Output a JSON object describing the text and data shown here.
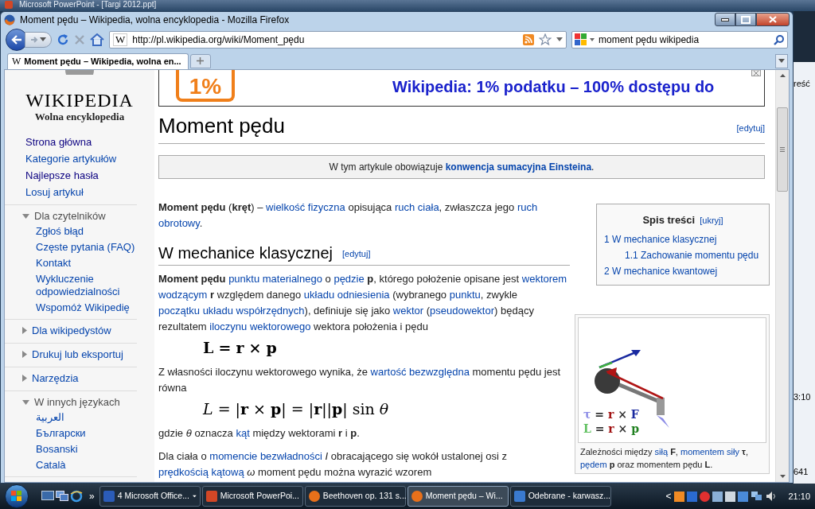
{
  "background_window": {
    "title": "Microsoft PowerPoint - [Targi 2012.ppt]"
  },
  "side_fragments": [
    "reść",
    "3:10",
    "641"
  ],
  "browser": {
    "title": "Moment pędu – Wikipedia, wolna encyklopedia - Mozilla Firefox",
    "url": "http://pl.wikipedia.org/wiki/Moment_pędu",
    "search": "moment pędu wikipedia",
    "favicon": "W",
    "tabs": [
      {
        "favicon": "W",
        "label": "Moment pędu – Wikipedia, wolna en...",
        "selected": true
      }
    ]
  },
  "sidebar": {
    "logo_title": "WIKIPEDIA",
    "logo_subtitle": "Wolna encyklopedia",
    "nav": [
      {
        "label": "Strona główna",
        "visited": true
      },
      {
        "label": "Kategorie artykułów",
        "visited": false
      },
      {
        "label": "Najlepsze hasła",
        "visited": true
      },
      {
        "label": "Losuj artykuł",
        "visited": false
      }
    ],
    "sections": [
      {
        "title": "Dla czytelników",
        "expanded": true,
        "items": [
          "Zgłoś błąd",
          "Częste pytania (FAQ)",
          "Kontakt",
          "Wykluczenie odpowiedzialności",
          "Wspomóż Wikipedię"
        ]
      },
      {
        "title": "Dla wikipedystów",
        "expanded": false
      },
      {
        "title": "Drukuj lub eksportuj",
        "expanded": false
      },
      {
        "title": "Narzędzia",
        "expanded": false
      },
      {
        "title": "W innych językach",
        "expanded": true,
        "items": [
          "العربية",
          "Български",
          "Bosanski",
          "Català"
        ]
      }
    ]
  },
  "banner": {
    "logo_text": "1%",
    "text": "Wikipedia: 1% podatku – 100% dostępu do"
  },
  "article": {
    "title": "Moment pędu",
    "edit": "[edytuj]",
    "notice": [
      {
        "kind": "text",
        "text": "W tym artykule obowiązuje "
      },
      {
        "kind": "link",
        "text": "**konwencja sumacyjna Einsteina**"
      },
      {
        "kind": "text",
        "text": "."
      }
    ],
    "toc": {
      "title": "Spis treści",
      "toggle": "[ukryj]",
      "items": [
        {
          "label": "1 W mechanice klasycznej",
          "children": [
            {
              "label": "1.1 Zachowanie momentu pędu"
            }
          ]
        },
        {
          "label": "2 W mechanice kwantowej"
        }
      ]
    },
    "intro": [
      {
        "kind": "text",
        "text": "**Moment pędu** (**kręt**) – "
      },
      {
        "kind": "link",
        "text": "wielkość fizyczna"
      },
      {
        "kind": "text",
        "text": " opisująca "
      },
      {
        "kind": "link",
        "text": "ruch ciała"
      },
      {
        "kind": "text",
        "text": ", zwłaszcza jego "
      },
      {
        "kind": "link",
        "text": "ruch"
      },
      {
        "kind": "link",
        "text": "obrotowy"
      },
      {
        "kind": "text",
        "text": "."
      }
    ],
    "section": {
      "title": "W mechanice klasycznej",
      "edit": "[edytuj]",
      "blocks": [
        {
          "kind": "paragraph",
          "parts": [
            {
              "kind": "text",
              "text": "**Moment pędu** "
            },
            {
              "kind": "link",
              "text": "punktu materialnego"
            },
            {
              "kind": "text",
              "text": " o "
            },
            {
              "kind": "link",
              "text": "pędzie"
            },
            {
              "kind": "text",
              "text": " **p**, którego położenie opisane jest "
            },
            {
              "kind": "link",
              "text": "wektorem"
            },
            {
              "kind": "link",
              "text": "wodzącym"
            },
            {
              "kind": "text",
              "text": " **r** względem danego "
            },
            {
              "kind": "link",
              "text": "układu odniesienia"
            },
            {
              "kind": "text",
              "text": " (wybranego "
            },
            {
              "kind": "link",
              "text": "punktu"
            },
            {
              "kind": "text",
              "text": ", zwykle "
            },
            {
              "kind": "link",
              "text": "początku układu współrzędnych"
            },
            {
              "kind": "text",
              "text": "), definiuje się jako "
            },
            {
              "kind": "link",
              "text": "wektor"
            },
            {
              "kind": "text",
              "text": " ("
            },
            {
              "kind": "link",
              "text": "pseudowektor"
            },
            {
              "kind": "text",
              "text": ") będący rezultatem "
            },
            {
              "kind": "link",
              "text": "iloczynu wektorowego"
            },
            {
              "kind": "text",
              "text": " wektora położenia i pędu"
            }
          ]
        },
        {
          "kind": "formula",
          "text": "**L** **=** **r** **×** **p**"
        },
        {
          "kind": "paragraph",
          "parts": [
            {
              "kind": "text",
              "text": "Z własności iloczynu wektorowego wynika, że "
            },
            {
              "kind": "link",
              "text": "wartość bezwzględna"
            },
            {
              "kind": "text",
              "text": " momentu pędu jest równa"
            }
          ]
        },
        {
          "kind": "formula",
          "text": "*L* = |**r** × **p**| = |**r**||**p**| sin *θ*"
        },
        {
          "kind": "paragraph",
          "parts": [
            {
              "kind": "text",
              "text": "gdzie *θ* oznacza "
            },
            {
              "kind": "link",
              "text": "kąt"
            },
            {
              "kind": "text",
              "text": " między wektorami **r** i **p**."
            }
          ]
        },
        {
          "kind": "paragraph",
          "parts": [
            {
              "kind": "text",
              "text": "Dla ciała o "
            },
            {
              "kind": "link",
              "text": "momencie bezwładności"
            },
            {
              "kind": "text",
              "text": " *I* obracającego się wokół ustalonej osi z "
            },
            {
              "kind": "link",
              "text": "prędkością kątową"
            },
            {
              "kind": "text",
              "text": " *ω* moment pędu można wyrazić wzorem"
            }
          ]
        }
      ]
    },
    "figure": {
      "labels": [
        [
          {
            "text": "τ",
            "color": "#8a8ae6"
          },
          {
            "text": " = "
          },
          {
            "text": "r",
            "color": "#a01010"
          },
          {
            "text": " × "
          },
          {
            "text": "F",
            "color": "#1a2aa0"
          }
        ],
        [
          {
            "text": "L",
            "color": "#60c060"
          },
          {
            "text": " = "
          },
          {
            "text": "r",
            "color": "#a01010"
          },
          {
            "text": " × "
          },
          {
            "text": "p",
            "color": "#208020"
          }
        ]
      ],
      "caption": [
        {
          "kind": "text",
          "text": "Zależności między "
        },
        {
          "kind": "link",
          "text": "siłą"
        },
        {
          "kind": "text",
          "text": " **F**, "
        },
        {
          "kind": "link",
          "text": "momentem siły"
        },
        {
          "kind": "text",
          "text": " **τ**, "
        },
        {
          "kind": "link",
          "text": "pędem"
        },
        {
          "kind": "text",
          "text": " **p** oraz momentem pędu **L**."
        }
      ]
    }
  },
  "taskbar": {
    "tasks": [
      {
        "label": "4 Microsoft Office...",
        "kind": "word",
        "selected": false,
        "grouped": true
      },
      {
        "label": "Microsoft PowerPoi...",
        "kind": "powerpoint",
        "selected": false,
        "grouped": false
      },
      {
        "label": "Beethoven op. 131 s...",
        "kind": "firefox",
        "selected": false,
        "grouped": false
      },
      {
        "label": "Moment pędu – Wi...",
        "kind": "firefox",
        "selected": true,
        "grouped": false
      },
      {
        "label": "Odebrane - karwasz...",
        "kind": "mail",
        "selected": false,
        "grouped": false
      }
    ],
    "more": "»",
    "tray_toggle": "<",
    "clock": "21:10"
  }
}
